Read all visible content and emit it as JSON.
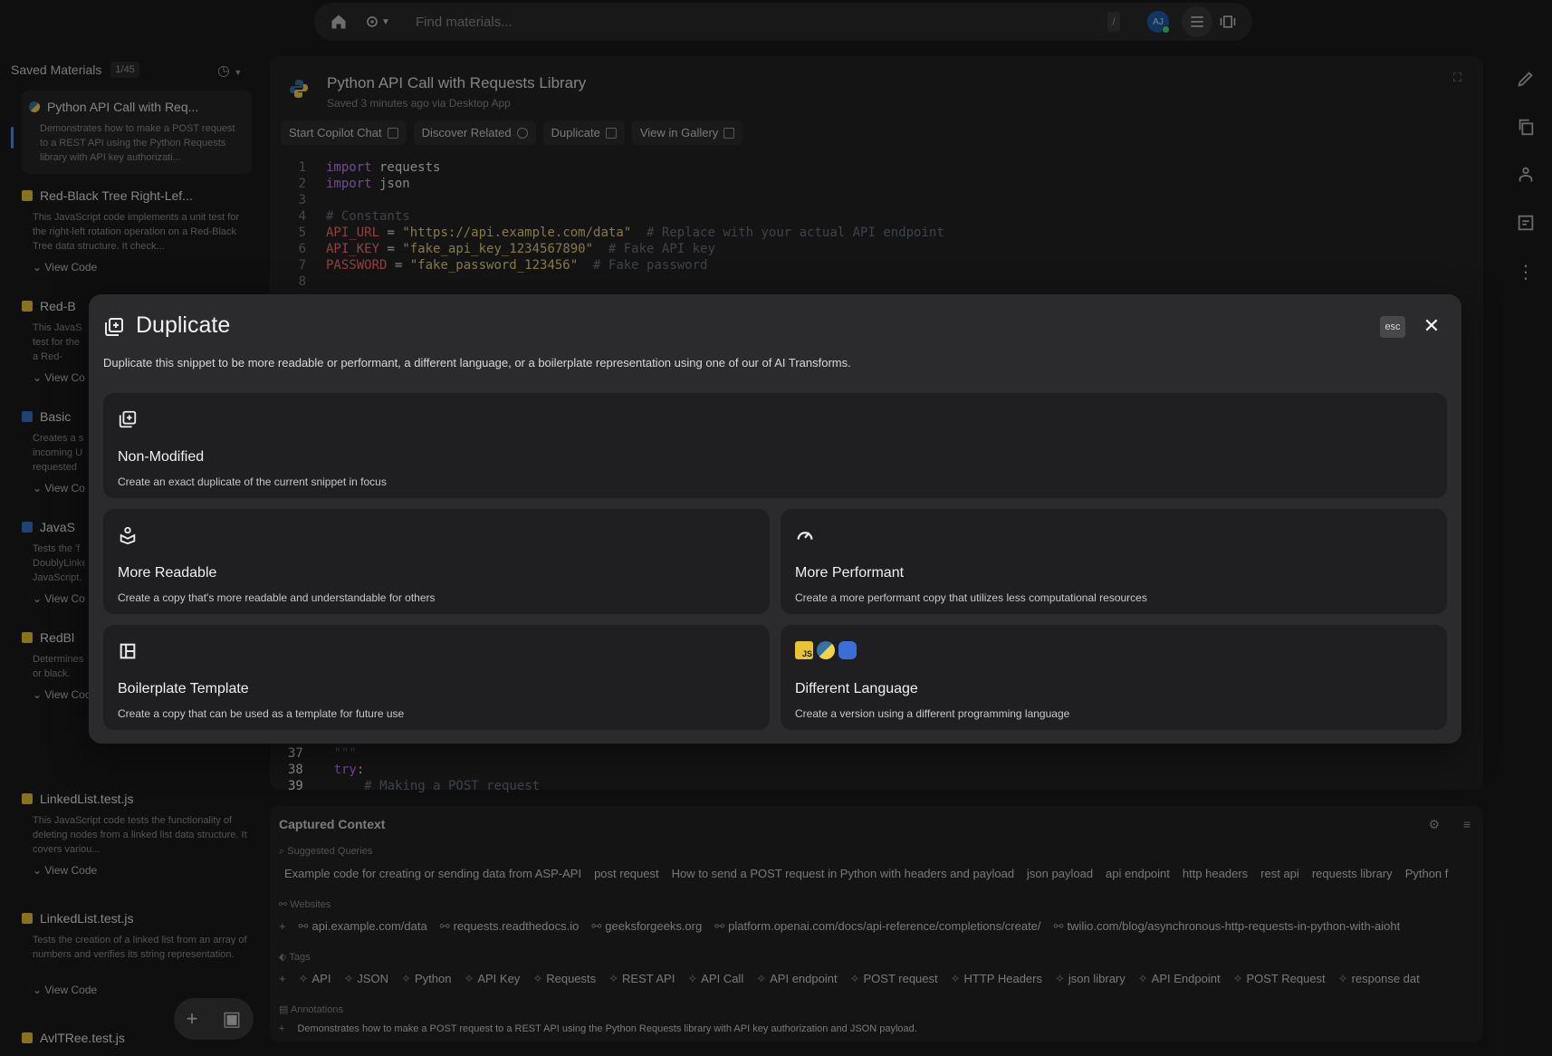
{
  "topbar": {
    "search_placeholder": "Find materials...",
    "slash_hint": "/",
    "avatar_initials": "AJ"
  },
  "sidebar": {
    "title": "Saved Materials",
    "count": "1/45",
    "items": [
      {
        "title": "Python API Call with Req...",
        "lang": "py",
        "desc": "Demonstrates how to make a POST request to a REST API using the Python Requests library with API key authorizati...",
        "view": ""
      },
      {
        "title": "Red-Black Tree Right-Lef...",
        "lang": "js",
        "desc": "This JavaScript code implements a unit test for the right-left rotation operation on a Red-Black Tree data structure. It check...",
        "view": "View Code"
      },
      {
        "title": "Red-B",
        "lang": "js",
        "desc": "This JavaS test for the a Red-Black",
        "view": "View Co"
      },
      {
        "title": "Basic",
        "lang": "ts",
        "desc": "Creates a s incoming U requested p",
        "view": "View Co"
      },
      {
        "title": "JavaS",
        "lang": "ts",
        "desc": "Tests the 'f DoublyLinke JavaScript,",
        "view": "View Co"
      },
      {
        "title": "RedBl",
        "lang": "js",
        "desc": "Determines or black.",
        "view": "View Code"
      },
      {
        "title": "LinkedList.test.js",
        "lang": "js",
        "desc": "This JavaScript code tests the functionality of deleting nodes from a linked list data structure. It covers variou...",
        "view": "View Code"
      },
      {
        "title": "LinkedList.test.js",
        "lang": "js",
        "desc": "Tests the creation of a linked list from an array of numbers and verifies its string representation.",
        "view": "View Code"
      },
      {
        "title": "AvlTRee.test.js",
        "lang": "js",
        "desc": "",
        "view": ""
      }
    ]
  },
  "editor": {
    "title": "Python API Call with Requests Library",
    "subtitle": "Saved 3 minutes ago via Desktop App",
    "actions": [
      "Start Copilot Chat",
      "Discover Related",
      "Duplicate",
      "View in Gallery"
    ],
    "lines": [
      {
        "n": "1",
        "kw": "import",
        "rest": " requests"
      },
      {
        "n": "2",
        "kw": "import",
        "rest": " json"
      },
      {
        "n": "3"
      },
      {
        "n": "4",
        "cm": "# Constants"
      },
      {
        "n": "5",
        "var": "API_URL",
        "op": " = ",
        "str": "\"https://api.example.com/data\"",
        "cm": "  # Replace with your actual API endpoint"
      },
      {
        "n": "6",
        "var": "API_KEY",
        "op": " = ",
        "str": "\"fake_api_key_1234567890\"",
        "cm": "  # Fake API key"
      },
      {
        "n": "7",
        "var": "PASSWORD",
        "op": " = ",
        "str": "\"fake_password_123456\"",
        "cm": "  # Fake password"
      },
      {
        "n": "8"
      }
    ],
    "tail_lines": [
      {
        "n": "37",
        "cm": "    \"\"\""
      },
      {
        "n": "38",
        "kw": "    try",
        "rest": ":"
      },
      {
        "n": "39",
        "cm": "        # Making a POST request"
      }
    ]
  },
  "context": {
    "title": "Captured Context",
    "queries_label": "Suggested Queries",
    "queries": [
      "Example code for creating or sending data from ASP-API",
      "post request",
      "How to send a POST request in Python with headers and payload",
      "json payload",
      "api endpoint",
      "http headers",
      "rest api",
      "requests library",
      "Python f"
    ],
    "websites_label": "Websites",
    "websites": [
      "api.example.com/data",
      "requests.readthedocs.io",
      "geeksforgeeks.org",
      "platform.openai.com/docs/api-reference/completions/create/",
      "twilio.com/blog/asynchronous-http-requests-in-python-with-aioht"
    ],
    "tags_label": "Tags",
    "tags": [
      "API",
      "JSON",
      "Python",
      "API Key",
      "Requests",
      "REST API",
      "API Call",
      "API endpoint",
      "POST request",
      "HTTP Headers",
      "json library",
      "API Endpoint",
      "POST Request",
      "response dat"
    ],
    "annotations_label": "Annotations",
    "annotation": "Demonstrates how to make a POST request to a REST API using the Python Requests library with API key authorization and JSON payload."
  },
  "modal": {
    "title": "Duplicate",
    "esc": "esc",
    "description": "Duplicate this snippet to be more readable or performant, a different language, or a boilerplate representation using one of our of AI Transforms.",
    "options": [
      {
        "title": "Non-Modified",
        "desc": "Create an exact duplicate of the current snippet in focus"
      },
      {
        "title": "More Readable",
        "desc": "Create a copy that's more readable and understandable for others"
      },
      {
        "title": "More Performant",
        "desc": "Create a more performant copy that utilizes less computational resources"
      },
      {
        "title": "Boilerplate Template",
        "desc": "Create a copy that can be used as a template for future use"
      },
      {
        "title": "Different Language",
        "desc": "Create a version using a different programming language"
      }
    ],
    "language_badges": [
      "JS",
      "PY",
      "DT"
    ]
  }
}
